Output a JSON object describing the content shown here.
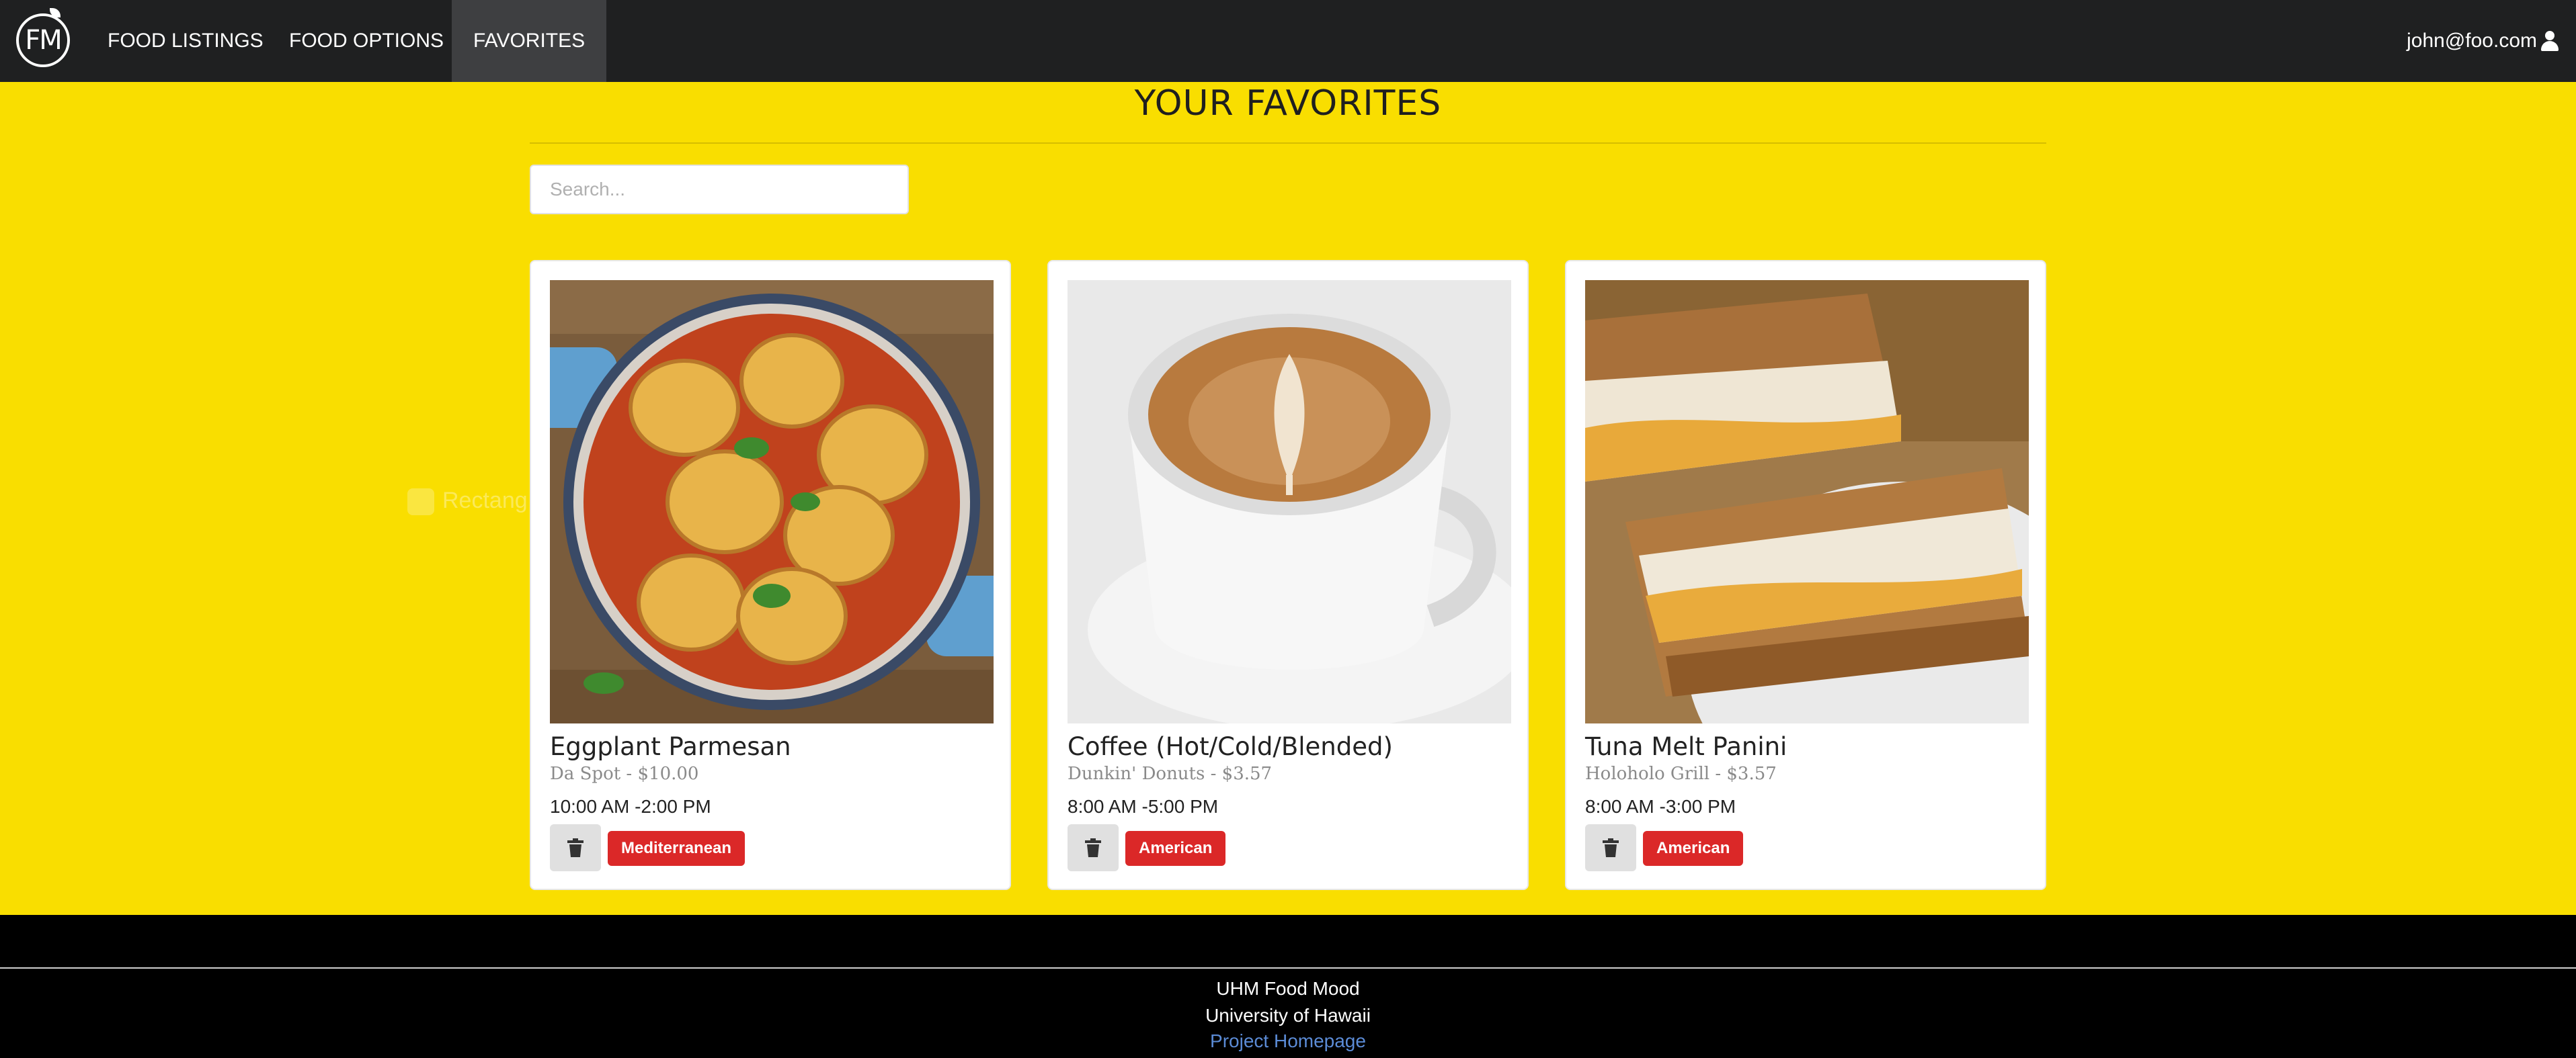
{
  "navbar": {
    "logo_text": "FM",
    "items": [
      {
        "label": "FOOD LISTINGS",
        "active": false
      },
      {
        "label": "FOOD OPTIONS",
        "active": false
      },
      {
        "label": "FAVORITES",
        "active": true
      }
    ],
    "user_email": "john@foo.com",
    "user_icon": "user-icon"
  },
  "main": {
    "title": "YOUR FAVORITES",
    "search_placeholder": "Search...",
    "ghost_text": "Rectang"
  },
  "cards": [
    {
      "name": "Eggplant Parmesan",
      "meta": "Da Spot - $10.00",
      "hours": "10:00 AM -2:00 PM",
      "tag": "Mediterranean",
      "image": "eggplant-parmesan"
    },
    {
      "name": "Coffee (Hot/Cold/Blended)",
      "meta": "Dunkin' Donuts - $3.57",
      "hours": "8:00 AM -5:00 PM",
      "tag": "American",
      "image": "coffee"
    },
    {
      "name": "Tuna Melt Panini",
      "meta": "Holoholo Grill - $3.57",
      "hours": "8:00 AM -3:00 PM",
      "tag": "American",
      "image": "tuna-melt-panini"
    }
  ],
  "footer": {
    "line1": "UHM Food Mood",
    "line2": "University of Hawaii",
    "link": "Project Homepage"
  },
  "colors": {
    "background": "#f9de00",
    "navbar": "#1f2021",
    "tag": "#db2828",
    "link": "#5b8bd6"
  }
}
